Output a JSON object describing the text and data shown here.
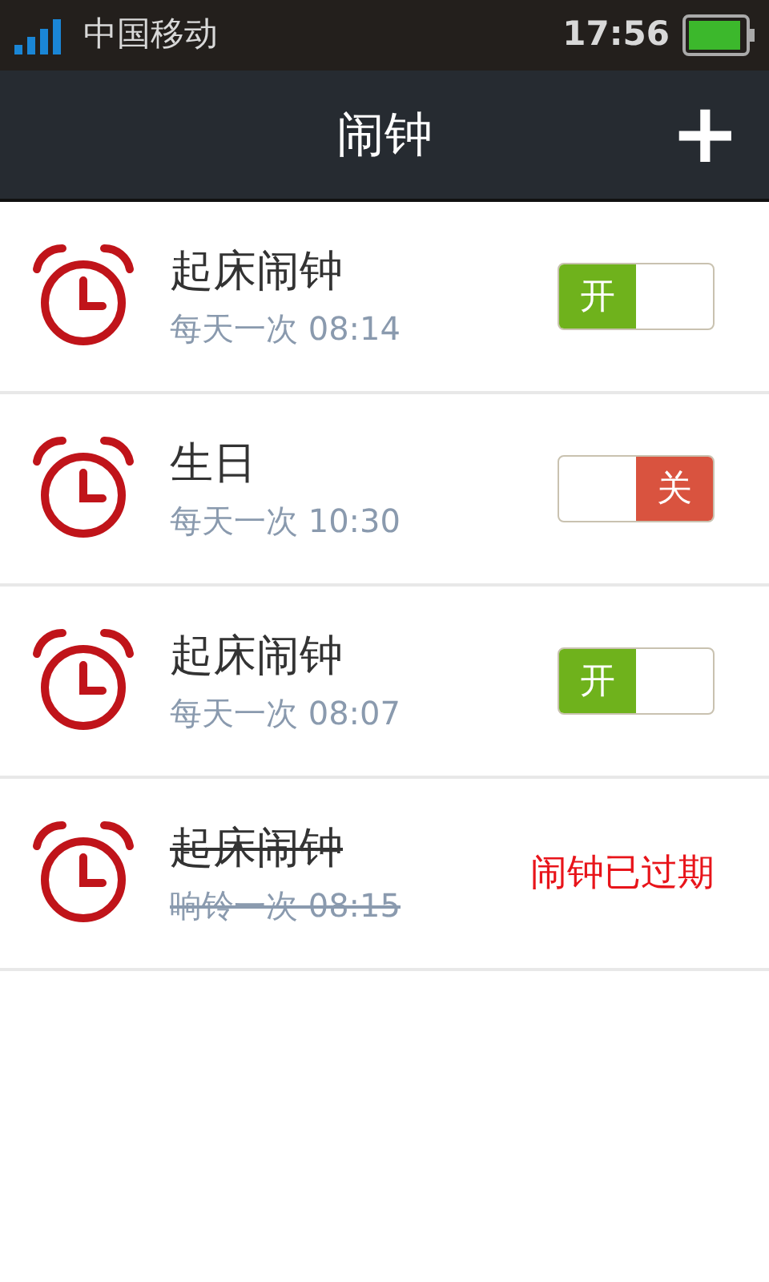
{
  "status_bar": {
    "carrier": "中国移动",
    "time": "17:56"
  },
  "header": {
    "title": "闹钟",
    "add_button": "+"
  },
  "alarms": [
    {
      "kind": "toggle",
      "name": "起床闹钟",
      "schedule": "每天一次 08:14",
      "on": true,
      "switch_label": "开"
    },
    {
      "kind": "toggle",
      "name": "生日",
      "schedule": "每天一次 10:30",
      "on": false,
      "switch_label": "关"
    },
    {
      "kind": "toggle",
      "name": "起床闹钟",
      "schedule": "每天一次 08:07",
      "on": true,
      "switch_label": "开"
    },
    {
      "kind": "expired",
      "name": "起床闹钟",
      "schedule": "响铃一次 08:15",
      "status": "闹钟已过期"
    }
  ]
}
